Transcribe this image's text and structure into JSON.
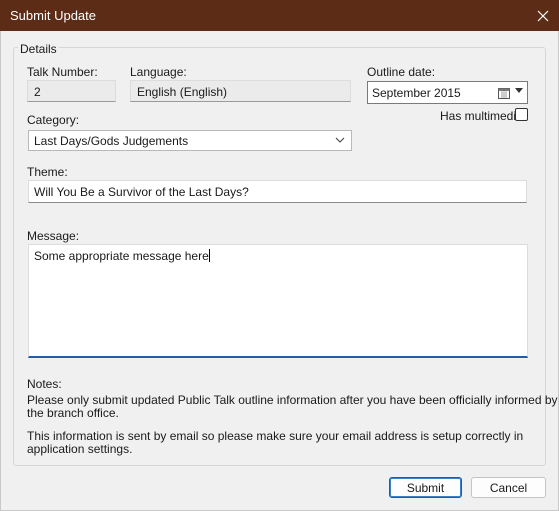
{
  "window": {
    "title": "Submit Update"
  },
  "details": {
    "group_title": "Details",
    "talk_number_label": "Talk Number:",
    "talk_number_value": "2",
    "language_label": "Language:",
    "language_value": "English (English)",
    "outline_date_label": "Outline date:",
    "outline_date_value": "September 2015",
    "has_multimedia_label": "Has multimedia",
    "has_multimedia_checked": false,
    "category_label": "Category:",
    "category_value": "Last Days/Gods Judgements",
    "theme_label": "Theme:",
    "theme_value": "Will You Be a Survivor of the Last Days?",
    "message_label": "Message:",
    "message_value": "Some appropriate message here",
    "notes_label": "Notes:",
    "notes_line1": "Please only submit updated Public Talk outline information after you have been officially informed by",
    "notes_line2": "the branch office.",
    "notes_line3": "This information is sent by email so please make sure your email address is setup correctly in",
    "notes_line4": "application settings."
  },
  "buttons": {
    "submit": "Submit",
    "cancel": "Cancel"
  },
  "icons": {
    "close": "close-icon",
    "calendar": "calendar-icon",
    "chevron": "chevron-down-icon"
  },
  "colors": {
    "titlebar": "#5c2c17",
    "focus": "#1a5fa8"
  }
}
